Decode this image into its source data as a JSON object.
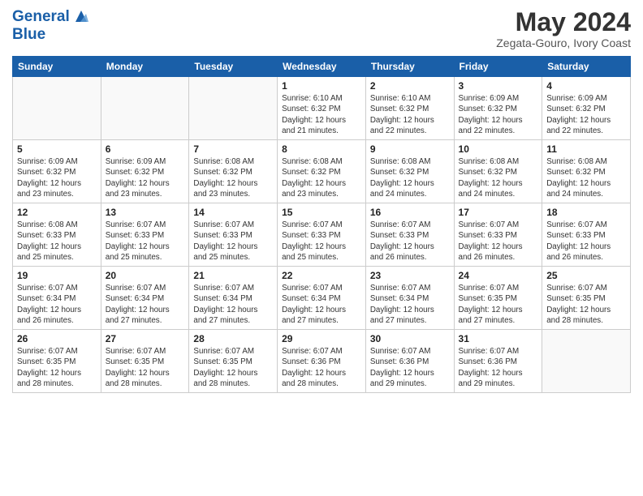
{
  "header": {
    "logo_line1": "General",
    "logo_line2": "Blue",
    "month": "May 2024",
    "location": "Zegata-Gouro, Ivory Coast"
  },
  "weekdays": [
    "Sunday",
    "Monday",
    "Tuesday",
    "Wednesday",
    "Thursday",
    "Friday",
    "Saturday"
  ],
  "weeks": [
    [
      {
        "day": "",
        "info": ""
      },
      {
        "day": "",
        "info": ""
      },
      {
        "day": "",
        "info": ""
      },
      {
        "day": "1",
        "info": "Sunrise: 6:10 AM\nSunset: 6:32 PM\nDaylight: 12 hours\nand 21 minutes."
      },
      {
        "day": "2",
        "info": "Sunrise: 6:10 AM\nSunset: 6:32 PM\nDaylight: 12 hours\nand 22 minutes."
      },
      {
        "day": "3",
        "info": "Sunrise: 6:09 AM\nSunset: 6:32 PM\nDaylight: 12 hours\nand 22 minutes."
      },
      {
        "day": "4",
        "info": "Sunrise: 6:09 AM\nSunset: 6:32 PM\nDaylight: 12 hours\nand 22 minutes."
      }
    ],
    [
      {
        "day": "5",
        "info": "Sunrise: 6:09 AM\nSunset: 6:32 PM\nDaylight: 12 hours\nand 23 minutes."
      },
      {
        "day": "6",
        "info": "Sunrise: 6:09 AM\nSunset: 6:32 PM\nDaylight: 12 hours\nand 23 minutes."
      },
      {
        "day": "7",
        "info": "Sunrise: 6:08 AM\nSunset: 6:32 PM\nDaylight: 12 hours\nand 23 minutes."
      },
      {
        "day": "8",
        "info": "Sunrise: 6:08 AM\nSunset: 6:32 PM\nDaylight: 12 hours\nand 23 minutes."
      },
      {
        "day": "9",
        "info": "Sunrise: 6:08 AM\nSunset: 6:32 PM\nDaylight: 12 hours\nand 24 minutes."
      },
      {
        "day": "10",
        "info": "Sunrise: 6:08 AM\nSunset: 6:32 PM\nDaylight: 12 hours\nand 24 minutes."
      },
      {
        "day": "11",
        "info": "Sunrise: 6:08 AM\nSunset: 6:32 PM\nDaylight: 12 hours\nand 24 minutes."
      }
    ],
    [
      {
        "day": "12",
        "info": "Sunrise: 6:08 AM\nSunset: 6:33 PM\nDaylight: 12 hours\nand 25 minutes."
      },
      {
        "day": "13",
        "info": "Sunrise: 6:07 AM\nSunset: 6:33 PM\nDaylight: 12 hours\nand 25 minutes."
      },
      {
        "day": "14",
        "info": "Sunrise: 6:07 AM\nSunset: 6:33 PM\nDaylight: 12 hours\nand 25 minutes."
      },
      {
        "day": "15",
        "info": "Sunrise: 6:07 AM\nSunset: 6:33 PM\nDaylight: 12 hours\nand 25 minutes."
      },
      {
        "day": "16",
        "info": "Sunrise: 6:07 AM\nSunset: 6:33 PM\nDaylight: 12 hours\nand 26 minutes."
      },
      {
        "day": "17",
        "info": "Sunrise: 6:07 AM\nSunset: 6:33 PM\nDaylight: 12 hours\nand 26 minutes."
      },
      {
        "day": "18",
        "info": "Sunrise: 6:07 AM\nSunset: 6:33 PM\nDaylight: 12 hours\nand 26 minutes."
      }
    ],
    [
      {
        "day": "19",
        "info": "Sunrise: 6:07 AM\nSunset: 6:34 PM\nDaylight: 12 hours\nand 26 minutes."
      },
      {
        "day": "20",
        "info": "Sunrise: 6:07 AM\nSunset: 6:34 PM\nDaylight: 12 hours\nand 27 minutes."
      },
      {
        "day": "21",
        "info": "Sunrise: 6:07 AM\nSunset: 6:34 PM\nDaylight: 12 hours\nand 27 minutes."
      },
      {
        "day": "22",
        "info": "Sunrise: 6:07 AM\nSunset: 6:34 PM\nDaylight: 12 hours\nand 27 minutes."
      },
      {
        "day": "23",
        "info": "Sunrise: 6:07 AM\nSunset: 6:34 PM\nDaylight: 12 hours\nand 27 minutes."
      },
      {
        "day": "24",
        "info": "Sunrise: 6:07 AM\nSunset: 6:35 PM\nDaylight: 12 hours\nand 27 minutes."
      },
      {
        "day": "25",
        "info": "Sunrise: 6:07 AM\nSunset: 6:35 PM\nDaylight: 12 hours\nand 28 minutes."
      }
    ],
    [
      {
        "day": "26",
        "info": "Sunrise: 6:07 AM\nSunset: 6:35 PM\nDaylight: 12 hours\nand 28 minutes."
      },
      {
        "day": "27",
        "info": "Sunrise: 6:07 AM\nSunset: 6:35 PM\nDaylight: 12 hours\nand 28 minutes."
      },
      {
        "day": "28",
        "info": "Sunrise: 6:07 AM\nSunset: 6:35 PM\nDaylight: 12 hours\nand 28 minutes."
      },
      {
        "day": "29",
        "info": "Sunrise: 6:07 AM\nSunset: 6:36 PM\nDaylight: 12 hours\nand 28 minutes."
      },
      {
        "day": "30",
        "info": "Sunrise: 6:07 AM\nSunset: 6:36 PM\nDaylight: 12 hours\nand 29 minutes."
      },
      {
        "day": "31",
        "info": "Sunrise: 6:07 AM\nSunset: 6:36 PM\nDaylight: 12 hours\nand 29 minutes."
      },
      {
        "day": "",
        "info": ""
      }
    ]
  ]
}
